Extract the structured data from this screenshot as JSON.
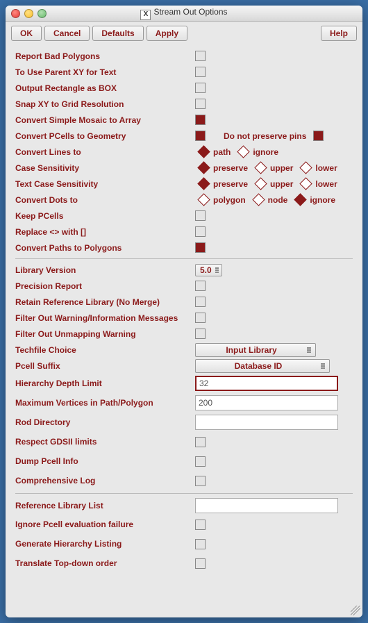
{
  "window": {
    "title_prefix": "X",
    "title": "Stream Out Options"
  },
  "buttons": {
    "ok": "OK",
    "cancel": "Cancel",
    "defaults": "Defaults",
    "apply": "Apply",
    "help": "Help"
  },
  "section1": [
    {
      "name": "report-bad-polygons",
      "label": "Report Bad Polygons",
      "checked": false
    },
    {
      "name": "use-parent-xy",
      "label": "To Use Parent XY for Text",
      "checked": false
    },
    {
      "name": "output-rect-box",
      "label": "Output Rectangle as BOX",
      "checked": false
    },
    {
      "name": "snap-xy-grid",
      "label": "Snap XY to Grid Resolution",
      "checked": false
    },
    {
      "name": "convert-mosaic-array",
      "label": "Convert Simple Mosaic to Array",
      "checked": true
    }
  ],
  "pcells_row": {
    "label": "Convert PCells to Geometry",
    "checked": true,
    "secondary_label": "Do not preserve pins",
    "secondary_checked": true
  },
  "radio_rows": [
    {
      "name": "convert-lines",
      "label": "Convert Lines to",
      "options": [
        "path",
        "ignore"
      ],
      "selected": 0
    },
    {
      "name": "case-sensitivity",
      "label": "Case Sensitivity",
      "options": [
        "preserve",
        "upper",
        "lower"
      ],
      "selected": 0
    },
    {
      "name": "text-case-sensitivity",
      "label": "Text Case Sensitivity",
      "options": [
        "preserve",
        "upper",
        "lower"
      ],
      "selected": 0
    },
    {
      "name": "convert-dots",
      "label": "Convert Dots to",
      "options": [
        "polygon",
        "node",
        "ignore"
      ],
      "selected": 2
    }
  ],
  "section1b": [
    {
      "name": "keep-pcells",
      "label": "Keep PCells",
      "checked": false
    },
    {
      "name": "replace-brackets",
      "label": "Replace <> with []",
      "checked": false
    },
    {
      "name": "convert-paths-polygons",
      "label": "Convert Paths to Polygons",
      "checked": true
    }
  ],
  "libver": {
    "label": "Library Version",
    "value": "5.0"
  },
  "section2": [
    {
      "name": "precision-report",
      "label": "Precision Report",
      "checked": false
    },
    {
      "name": "retain-ref-lib",
      "label": "Retain Reference Library (No Merge)",
      "checked": false
    },
    {
      "name": "filter-warn-info",
      "label": "Filter Out Warning/Information Messages",
      "checked": false
    },
    {
      "name": "filter-unmap-warn",
      "label": "Filter Out Unmapping Warning",
      "checked": false
    }
  ],
  "techfile": {
    "label": "Techfile Choice",
    "value": "Input Library"
  },
  "pcell_suffix": {
    "label": "Pcell Suffix",
    "value": "Database ID"
  },
  "text_rows": [
    {
      "name": "hier-depth",
      "label": "Hierarchy Depth Limit",
      "value": "32",
      "focused": true
    },
    {
      "name": "max-vertices",
      "label": "Maximum Vertices in Path/Polygon",
      "value": "200",
      "focused": false
    },
    {
      "name": "rod-dir",
      "label": "Rod Directory",
      "value": "",
      "focused": false
    }
  ],
  "section3": [
    {
      "name": "respect-gdsii",
      "label": "Respect GDSII limits",
      "checked": false
    },
    {
      "name": "dump-pcell-info",
      "label": "Dump Pcell Info",
      "checked": false
    },
    {
      "name": "comprehensive-log",
      "label": "Comprehensive Log",
      "checked": false
    }
  ],
  "ref_lib": {
    "label": "Reference Library List",
    "value": ""
  },
  "section4": [
    {
      "name": "ignore-pcell-eval",
      "label": "Ignore Pcell evaluation failure",
      "checked": false
    },
    {
      "name": "gen-hier-listing",
      "label": "Generate Hierarchy Listing",
      "checked": false
    },
    {
      "name": "translate-topdown",
      "label": "Translate Top-down order",
      "checked": false
    }
  ]
}
